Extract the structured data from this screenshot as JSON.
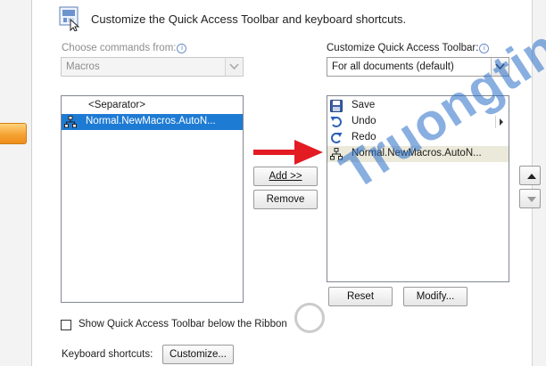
{
  "header": {
    "title": "Customize the Quick Access Toolbar and keyboard shortcuts."
  },
  "left_panel": {
    "label": "Choose commands from:",
    "combo_value": "Macros",
    "items": [
      "<Separator>",
      "Normal.NewMacros.AutoN..."
    ]
  },
  "right_panel": {
    "label": "Customize Quick Access Toolbar:",
    "combo_value": "For all documents (default)",
    "items": [
      "Save",
      "Undo",
      "Redo",
      "Normal.NewMacros.AutoN..."
    ]
  },
  "buttons": {
    "add": "Add >>",
    "remove": "Remove",
    "reset": "Reset",
    "modify": "Modify...",
    "customize": "Customize..."
  },
  "options": {
    "show_below_ribbon": "Show Quick Access Toolbar below the Ribbon",
    "show_below_ribbon_checked": false,
    "keyboard_shortcuts_label": "Keyboard shortcuts:"
  },
  "watermark": {
    "text": "Truongtin.top"
  },
  "colors": {
    "selection": "#1e7bd4",
    "arrow": "#e31b23",
    "watermark": "#286ec8",
    "accent_tab": "#f6a335"
  }
}
